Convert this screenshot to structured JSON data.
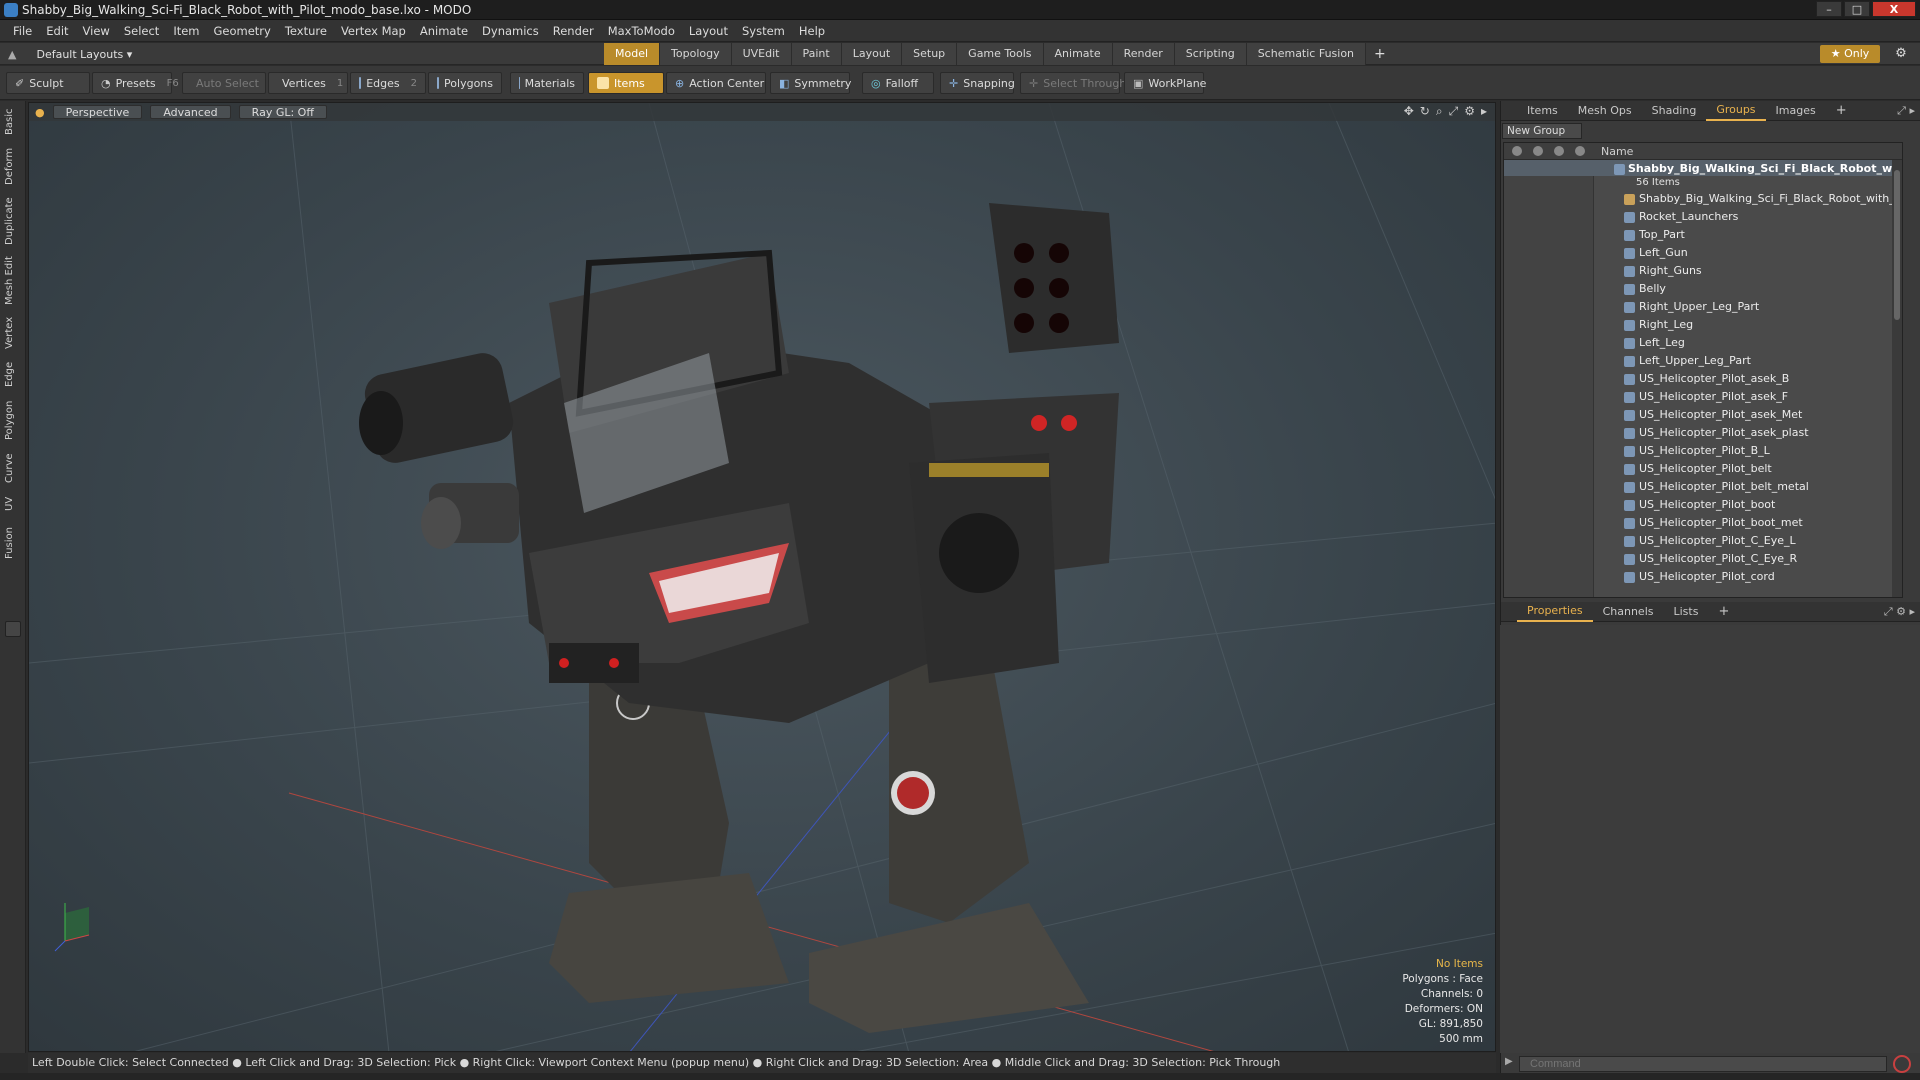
{
  "window": {
    "title": "Shabby_Big_Walking_Sci-Fi_Black_Robot_with_Pilot_modo_base.lxo - MODO",
    "buttons": [
      "–",
      "□",
      "X"
    ]
  },
  "menubar": {
    "items": [
      "File",
      "Edit",
      "View",
      "Select",
      "Item",
      "Geometry",
      "Texture",
      "Vertex Map",
      "Animate",
      "Dynamics",
      "Render",
      "MaxToModo",
      "Layout",
      "System",
      "Help"
    ]
  },
  "layoutbar": {
    "layout_select": "Default Layouts ▾",
    "tabs": [
      "Model",
      "Topology",
      "UVEdit",
      "Paint",
      "Layout",
      "Setup",
      "Game Tools",
      "Animate",
      "Render",
      "Scripting",
      "Schematic Fusion"
    ],
    "active_tab": "Model",
    "add": "+",
    "only": "★ Only",
    "gear": "⚙"
  },
  "toolbar": {
    "sculpt": "Sculpt",
    "presets": "Presets",
    "presets_key": "F6",
    "auto_select": "Auto Select",
    "vertices": "Vertices",
    "vertices_key": "1",
    "edges": "Edges",
    "edges_key": "2",
    "polygons": "Polygons",
    "materials": "Materials",
    "items": "Items",
    "action_center": "Action Center",
    "symmetry": "Symmetry",
    "falloff": "Falloff",
    "snapping": "Snapping",
    "select_through": "Select Through",
    "workplane": "WorkPlane"
  },
  "leftbar": {
    "tabs": [
      "Basic",
      "Deform",
      "Duplicate",
      "Mesh Edit",
      "Vertex",
      "Edge",
      "Polygon",
      "Curve",
      "UV",
      "Fusion"
    ]
  },
  "viewport": {
    "tabs": [
      "Perspective",
      "Advanced",
      "Ray GL: Off"
    ],
    "icons": [
      "✥",
      "↻",
      "⌕",
      "⤢",
      "⚙",
      "▸"
    ],
    "info": {
      "selection": "No Items",
      "polygons": "Polygons : Face",
      "channels": "Channels: 0",
      "deformers": "Deformers: ON",
      "gl": "GL: 891,850",
      "scale": "500 mm"
    }
  },
  "statusbar": {
    "text": "Left Double Click: Select Connected ● Left Click and Drag: 3D Selection: Pick ● Right Click: Viewport Context Menu (popup menu) ● Right Click and Drag: 3D Selection: Area ● Middle Click and Drag: 3D Selection: Pick Through"
  },
  "top_panel": {
    "tabs": [
      "Items",
      "Mesh Ops",
      "Shading",
      "Groups",
      "Images",
      "+"
    ],
    "active_tab": "Groups",
    "new_group": "New Group",
    "name_header": "Name",
    "root": {
      "label": "Shabby_Big_Walking_Sci_Fi_Black_Robot_wit...",
      "count": "56 Items"
    },
    "items": [
      "Shabby_Big_Walking_Sci_Fi_Black_Robot_with_Pilot",
      "Rocket_Launchers",
      "Top_Part",
      "Left_Gun",
      "Right_Guns",
      "Belly",
      "Right_Upper_Leg_Part",
      "Right_Leg",
      "Left_Leg",
      "Left_Upper_Leg_Part",
      "US_Helicopter_Pilot_asek_B",
      "US_Helicopter_Pilot_asek_F",
      "US_Helicopter_Pilot_asek_Met",
      "US_Helicopter_Pilot_asek_plast",
      "US_Helicopter_Pilot_B_L",
      "US_Helicopter_Pilot_belt",
      "US_Helicopter_Pilot_belt_metal",
      "US_Helicopter_Pilot_boot",
      "US_Helicopter_Pilot_boot_met",
      "US_Helicopter_Pilot_C_Eye_L",
      "US_Helicopter_Pilot_C_Eye_R",
      "US_Helicopter_Pilot_cord"
    ]
  },
  "bottom_panel": {
    "tabs": [
      "Properties",
      "Channels",
      "Lists",
      "+"
    ],
    "active_tab": "Properties"
  },
  "command": {
    "placeholder": "Command"
  },
  "colors": {
    "accent": "#c9952c",
    "tab_active_text": "#e9b24e",
    "viewport_bg": "#3e4a51"
  }
}
